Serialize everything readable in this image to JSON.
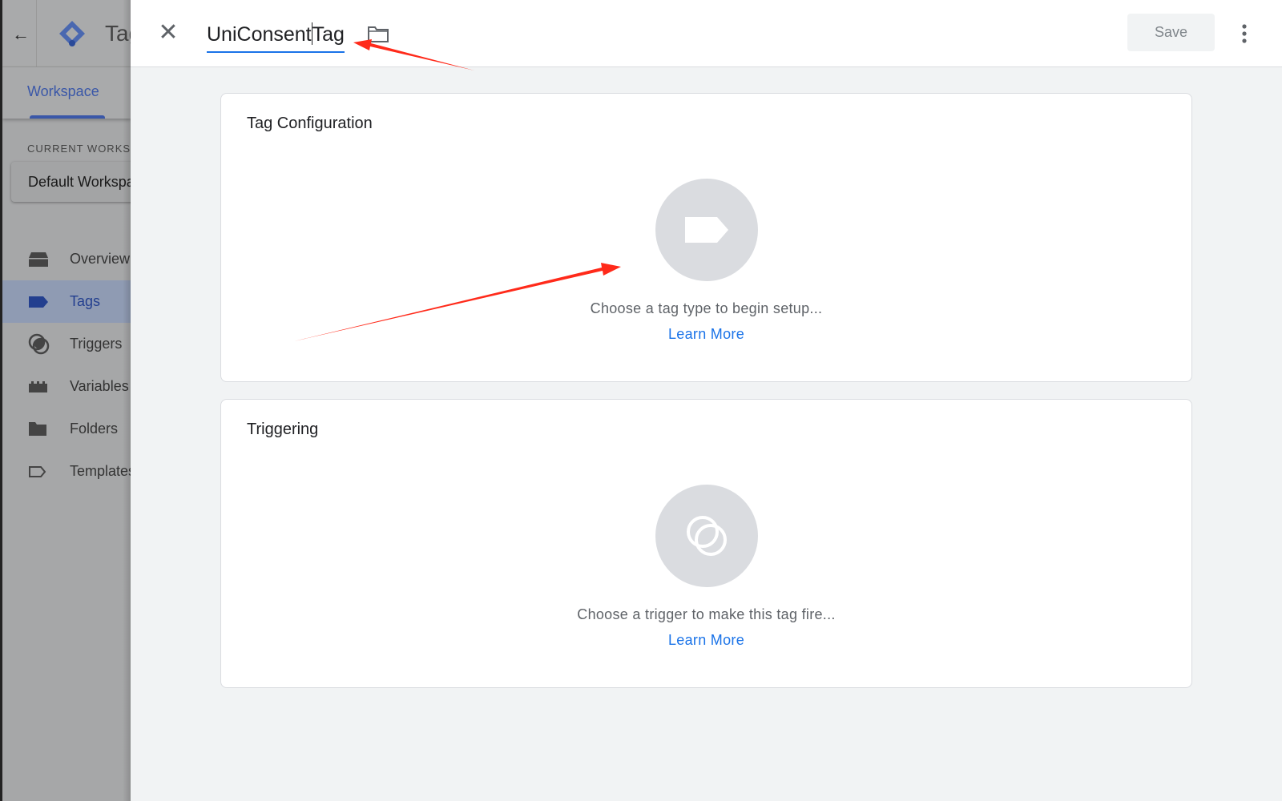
{
  "sidebar": {
    "app_title": "Tag Manager",
    "tab": "Workspace",
    "current_workspace_label": "CURRENT WORKSPACE",
    "workspace_name": "Default Workspace",
    "items": [
      {
        "label": "Overview",
        "icon": "overview-icon"
      },
      {
        "label": "Tags",
        "icon": "tag-icon",
        "selected": true
      },
      {
        "label": "Triggers",
        "icon": "trigger-icon"
      },
      {
        "label": "Variables",
        "icon": "variables-icon"
      },
      {
        "label": "Folders",
        "icon": "folder-icon"
      },
      {
        "label": "Templates",
        "icon": "template-icon"
      }
    ]
  },
  "header": {
    "tag_name": "UniConsent",
    "tag_name_after_cursor": "Tag",
    "save_label": "Save"
  },
  "tag_configuration": {
    "title": "Tag Configuration",
    "message": "Choose a tag type to begin setup...",
    "link": "Learn More"
  },
  "triggering": {
    "title": "Triggering",
    "message": "Choose a trigger to make this tag fire...",
    "link": "Learn More"
  },
  "colors": {
    "accent": "#1a73e8",
    "annotation": "#ff2a1a",
    "sidebar_selected": "#233f8f"
  }
}
